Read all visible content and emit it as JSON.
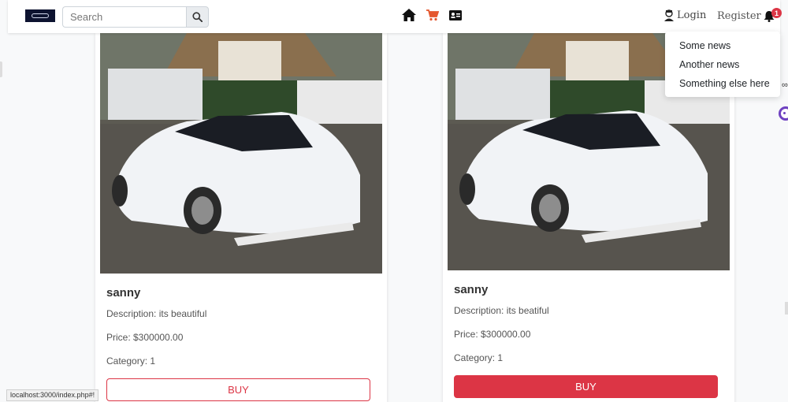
{
  "navbar": {
    "search": {
      "placeholder": "Search",
      "value": ""
    },
    "icons": [
      "home-icon",
      "cart-icon",
      "id-card-icon"
    ],
    "login_label": "Login",
    "register_label": "Register",
    "notification_count": "1"
  },
  "dropdown": {
    "items": [
      "Some news",
      "Another news",
      "Something else here"
    ]
  },
  "products": [
    {
      "name": "sanny",
      "description": "Description: its beautiful",
      "price": "Price: $300000.00",
      "category": "Category: 1",
      "buy_label": "BUY",
      "button_style": "outline"
    },
    {
      "name": "sanny",
      "description": "Description: its beatiful",
      "price": "Price: $300000.00",
      "category": "Category: 1",
      "buy_label": "BUY",
      "button_style": "filled"
    }
  ],
  "status_bar": {
    "url": "localhost:3000/index.php#!"
  },
  "colors": {
    "accent": "#dc3545",
    "navbar_bg": "#ffffff",
    "page_bg": "#f8f9fa",
    "cart": "#e4572e"
  }
}
